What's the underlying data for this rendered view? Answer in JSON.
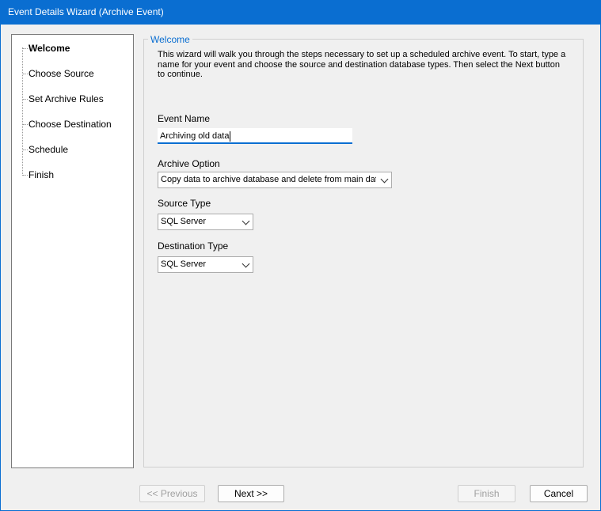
{
  "window": {
    "title": "Event Details Wizard (Archive Event)"
  },
  "steps": [
    {
      "label": "Welcome",
      "active": true
    },
    {
      "label": "Choose Source",
      "active": false
    },
    {
      "label": "Set Archive Rules",
      "active": false
    },
    {
      "label": "Choose Destination",
      "active": false
    },
    {
      "label": "Schedule",
      "active": false
    },
    {
      "label": "Finish",
      "active": false
    }
  ],
  "content": {
    "group_title": "Welcome",
    "intro": "This wizard will walk you through the steps necessary to set up a scheduled archive event. To start, type a name for your event and choose the source and destination database types. Then select the Next button to continue.",
    "event_name": {
      "label": "Event Name",
      "value": "Archiving old data"
    },
    "archive_option": {
      "label": "Archive Option",
      "value": "Copy data to archive database and delete from main datab"
    },
    "source_type": {
      "label": "Source Type",
      "value": "SQL Server"
    },
    "destination_type": {
      "label": "Destination Type",
      "value": "SQL Server"
    }
  },
  "buttons": {
    "previous": "<< Previous",
    "next": "Next >>",
    "finish": "Finish",
    "cancel": "Cancel"
  },
  "colors": {
    "accent": "#0a6ed1"
  }
}
